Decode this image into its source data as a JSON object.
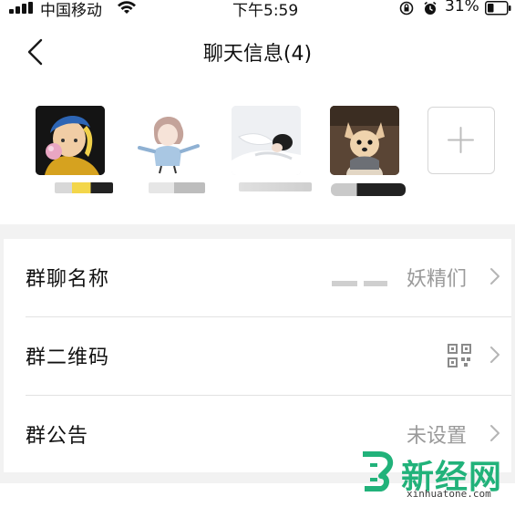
{
  "status_bar": {
    "carrier": "中国移动",
    "time": "下午5:59",
    "battery": "31%"
  },
  "header": {
    "title": "聊天信息(4)",
    "back_icon": "chevron-left-icon"
  },
  "members": [
    {
      "name": "",
      "avatar": "pearl-earring-girl-avatar"
    },
    {
      "name": "",
      "avatar": "anime-girl-avatar"
    },
    {
      "name": "",
      "avatar": "sleeping-person-avatar"
    },
    {
      "name": "",
      "avatar": "puppy-avatar"
    }
  ],
  "add_member": {
    "icon": "plus-icon"
  },
  "settings": {
    "group_name": {
      "label": "群聊名称",
      "value": "妖精们"
    },
    "qr_code": {
      "label": "群二维码",
      "icon": "qr-code-icon"
    },
    "announcement": {
      "label": "群公告",
      "value": "未设置"
    }
  },
  "watermark": {
    "text": "新经网",
    "url": "xinhuatone.com",
    "color": "#21b27a"
  },
  "colors": {
    "background": "#f2f2f2",
    "secondary_text": "#9a9a9a",
    "divider": "#e2e2e2"
  }
}
